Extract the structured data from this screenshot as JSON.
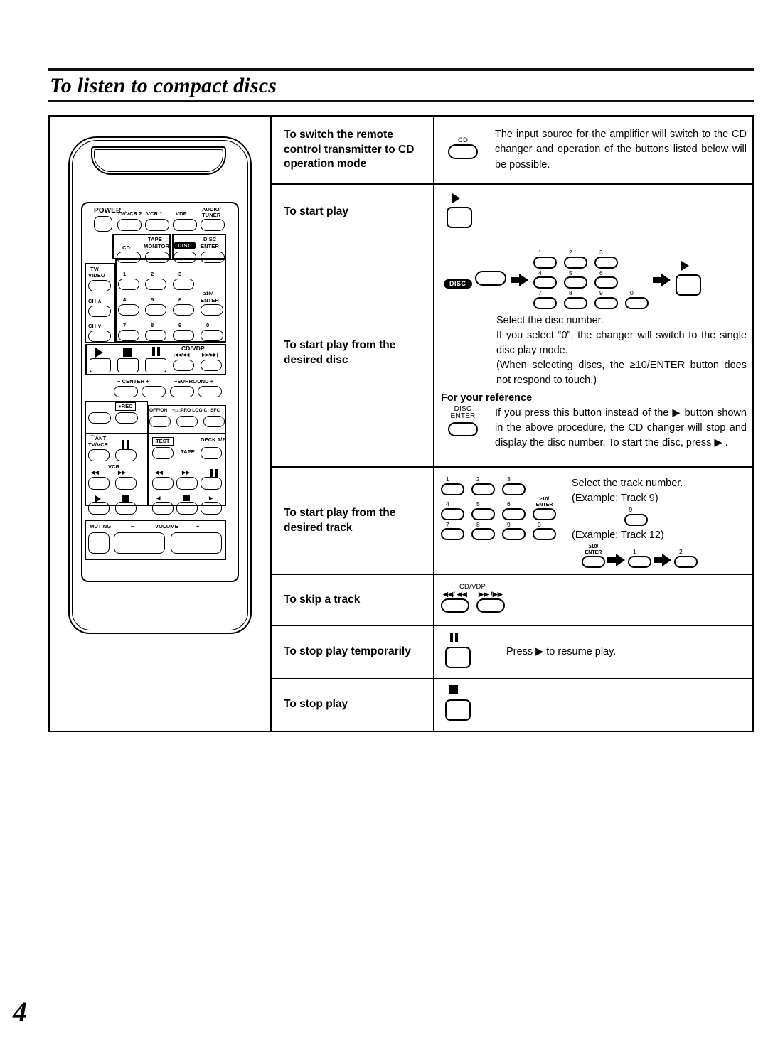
{
  "page": {
    "title": "To listen to compact discs",
    "number": "4"
  },
  "table": {
    "rows": [
      {
        "id": "switch-to-cd",
        "label": "To switch the remote control transmitter to CD operation mode",
        "button_caption": "CD",
        "text": "The input source for the amplifier will switch to the CD changer and operation of the buttons listed below will be possible."
      },
      {
        "id": "start-play",
        "label": "To start play",
        "button_caption": "play",
        "text": ""
      },
      {
        "id": "start-play-disc",
        "label": "To start play from the desired disc",
        "disc_button_caption": "DISC",
        "keypad": [
          "1",
          "2",
          "3",
          "4",
          "5",
          "6",
          "7",
          "8",
          "9",
          "0"
        ],
        "play_button_caption": "play",
        "text_lines": [
          "Select the disc number.",
          "If you select “0”, the changer will switch to the single disc play mode.",
          "(When selecting discs, the ≥10/ENTER button does not respond to touch.)"
        ],
        "reference": {
          "title": "For your reference",
          "button_caption_line1": "DISC",
          "button_caption_line2": "ENTER",
          "text": "If you press this button instead of the ▶ button shown in the above procedure, the CD changer will stop and display the disc number. To start the disc, press ▶ ."
        }
      },
      {
        "id": "start-play-track",
        "label": "To start play from the desired track",
        "keypad": [
          "1",
          "2",
          "3",
          "4",
          "5",
          "6",
          "7",
          "8",
          "9",
          "0"
        ],
        "enter_caption_line1": "≥10/",
        "enter_caption_line2": "ENTER",
        "instruction": "Select the track number.",
        "example_9": "(Example: Track 9)",
        "example_9_key": "9",
        "example_12": "(Example: Track 12)",
        "example_12_keys": [
          "1",
          "2"
        ]
      },
      {
        "id": "skip-track",
        "label": "To skip a track",
        "group_caption": "CD/VDP",
        "left_caption": "◀◀/ ◀◀",
        "right_caption": "▶▶ /▶▶",
        "text": ""
      },
      {
        "id": "pause",
        "label": "To stop play temporarily",
        "button_caption": "pause",
        "text": "Press ▶ to resume play."
      },
      {
        "id": "stop",
        "label": "To stop play",
        "button_caption": "stop",
        "text": ""
      }
    ]
  },
  "remote": {
    "alt": "remote control transmitter illustration",
    "labels": {
      "power": "POWER",
      "tvvcr2": "TV/VCR 2",
      "vcr1": "VCR 1",
      "vdp": "VDP",
      "audio_tuner_1": "AUDIO/",
      "audio_tuner_2": "TUNER",
      "cd": "CD",
      "tape_1": "TAPE",
      "tape_2": "MONITOR",
      "disc": "DISC",
      "disc_enter_1": "DISC",
      "disc_enter_2": "ENTER",
      "tv_video_1": "TV/",
      "tv_video_2": "VIDEO",
      "ch_up": "CH ∧",
      "ch_down": "CH ∨",
      "ge10_enter_1": "≥10/",
      "ge10_enter_2": "ENTER",
      "num1": "1",
      "num2": "2",
      "num3": "3",
      "num4": "4",
      "num5": "5",
      "num6": "6",
      "num7": "7",
      "num8": "8",
      "num9": "9",
      "num0": "0",
      "cdvdp": "CD/VDP",
      "center": "− CENTER +",
      "surround": "−SURROUND +",
      "rec": "●REC",
      "offon": "OFF/ON",
      "dolby": "−□□PRO LOGIC",
      "sfc": "SFC",
      "ant": "⌒ANT",
      "tvvcr": "TV/VCR",
      "vcr": "VCR",
      "test": "TEST",
      "deck": "DECK 1/2",
      "tape_btn": "TAPE",
      "muting": "MUTING",
      "volume_minus": "−",
      "volume": "VOLUME",
      "volume_plus": "+"
    }
  },
  "colors": {
    "ink": "#000000",
    "paper": "#ffffff"
  }
}
